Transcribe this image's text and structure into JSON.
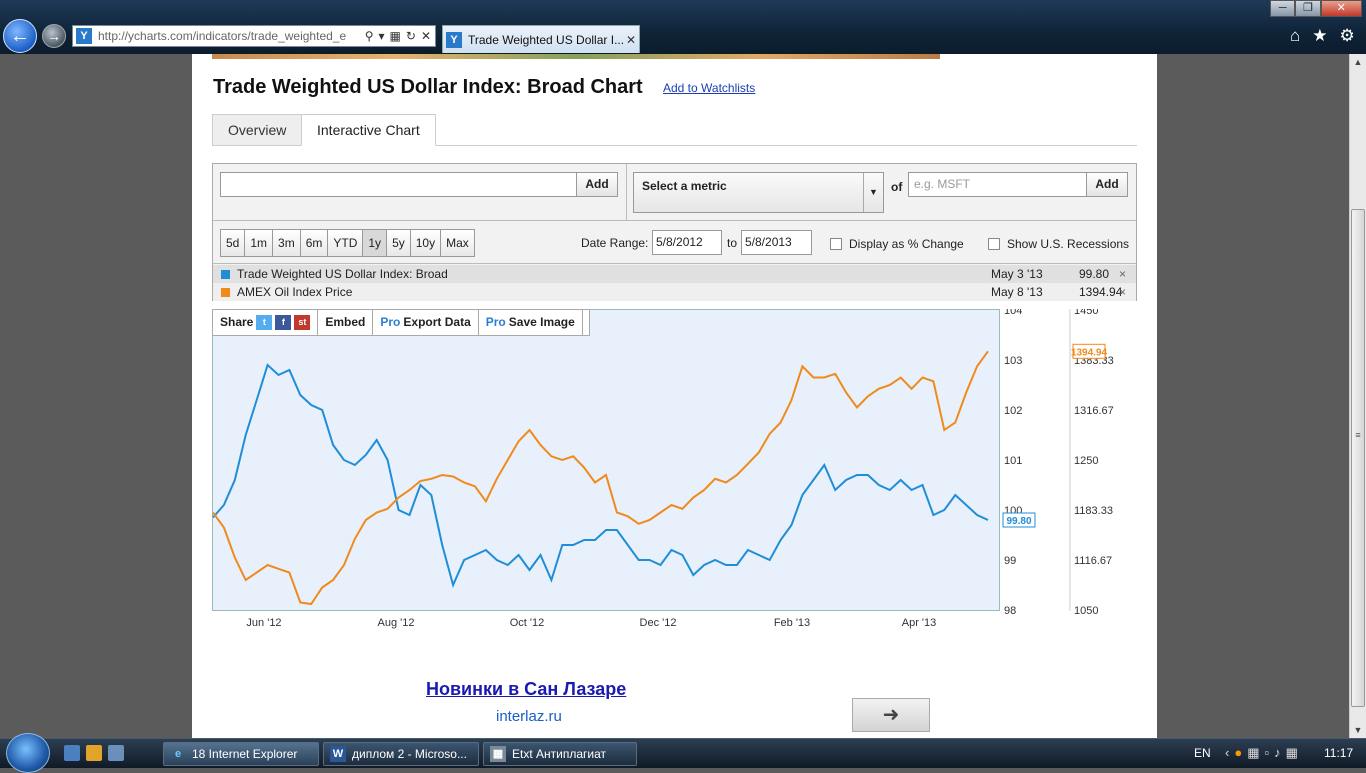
{
  "browser": {
    "url": "http://ycharts.com/indicators/trade_weighted_e",
    "tab_title": "Trade Weighted US Dollar I...",
    "favicon_letter": "Y"
  },
  "page": {
    "title": "Trade Weighted US Dollar Index: Broad Chart",
    "watchlist_link": "Add to Watchlists",
    "tabs": [
      "Overview",
      "Interactive Chart"
    ],
    "controls": {
      "add_label": "Add",
      "metric_placeholder": "Select a metric",
      "of_label": "of",
      "ticker_placeholder": "e.g. MSFT",
      "ranges": [
        "5d",
        "1m",
        "3m",
        "6m",
        "YTD",
        "1y",
        "5y",
        "10y",
        "Max"
      ],
      "active_range": "1y",
      "date_range_label": "Date Range:",
      "date_from": "5/8/2012",
      "to_label": "to",
      "date_to": "5/8/2013",
      "pct_change_label": "Display as % Change",
      "recessions_label": "Show U.S. Recessions"
    },
    "legend": [
      {
        "name": "Trade Weighted US Dollar Index: Broad",
        "date": "May 3 '13",
        "value": "99.80",
        "color": "#1f8ed6"
      },
      {
        "name": "AMEX Oil Index Price",
        "date": "May 8 '13",
        "value": "1394.94",
        "color": "#f08a1c"
      }
    ],
    "toolbar": {
      "share": "Share",
      "embed": "Embed",
      "pro": "Pro",
      "export": "Export Data",
      "save": "Save Image"
    },
    "cta": {
      "title": "Новинки в Сан Лазаре",
      "url": "interlaz.ru"
    }
  },
  "chart_data": {
    "type": "line",
    "x_labels": [
      "Jun '12",
      "Aug '12",
      "Oct '12",
      "Dec '12",
      "Feb '13",
      "Apr '13"
    ],
    "left_axis": {
      "ticks": [
        "104",
        "103",
        "102",
        "101",
        "100",
        "99",
        "98"
      ],
      "ylim": [
        98,
        104
      ]
    },
    "right_axis": {
      "ticks": [
        "1450",
        "1383.33",
        "1316.67",
        "1250",
        "1183.33",
        "1116.67",
        "1050"
      ],
      "ylim": [
        1050,
        1450
      ]
    },
    "series": [
      {
        "name": "Trade Weighted US Dollar Index: Broad",
        "axis": "left",
        "color": "#1f8ed6",
        "last_label": "99.80",
        "values": [
          99.85,
          100.1,
          100.6,
          101.5,
          102.2,
          102.9,
          102.7,
          102.8,
          102.3,
          102.1,
          102.0,
          101.3,
          101.0,
          100.9,
          101.1,
          101.4,
          101.0,
          100.0,
          99.9,
          100.5,
          100.3,
          99.3,
          98.5,
          99.0,
          99.1,
          99.2,
          99.0,
          98.9,
          99.1,
          98.8,
          99.1,
          98.6,
          99.3,
          99.3,
          99.4,
          99.4,
          99.6,
          99.6,
          99.3,
          99.0,
          99.0,
          98.9,
          99.2,
          99.1,
          98.7,
          98.9,
          99.0,
          98.9,
          98.9,
          99.2,
          99.1,
          99.0,
          99.4,
          99.7,
          100.3,
          100.6,
          100.9,
          100.4,
          100.6,
          100.7,
          100.7,
          100.5,
          100.4,
          100.6,
          100.4,
          100.5,
          99.9,
          100.0,
          100.3,
          100.1,
          99.9,
          99.8
        ]
      },
      {
        "name": "AMEX Oil Index Price",
        "axis": "right",
        "color": "#f08a1c",
        "last_label": "1394.94",
        "values": [
          1180,
          1160,
          1120,
          1090,
          1100,
          1110,
          1105,
          1100,
          1060,
          1058,
          1080,
          1090,
          1110,
          1145,
          1170,
          1180,
          1185,
          1200,
          1210,
          1222,
          1225,
          1230,
          1228,
          1220,
          1215,
          1195,
          1225,
          1250,
          1275,
          1290,
          1270,
          1255,
          1250,
          1255,
          1240,
          1220,
          1230,
          1180,
          1175,
          1165,
          1170,
          1180,
          1190,
          1185,
          1200,
          1210,
          1225,
          1220,
          1230,
          1245,
          1260,
          1285,
          1300,
          1330,
          1375,
          1360,
          1360,
          1365,
          1340,
          1320,
          1335,
          1345,
          1350,
          1360,
          1345,
          1360,
          1355,
          1290,
          1300,
          1340,
          1375,
          1394.94
        ]
      }
    ]
  }
}
